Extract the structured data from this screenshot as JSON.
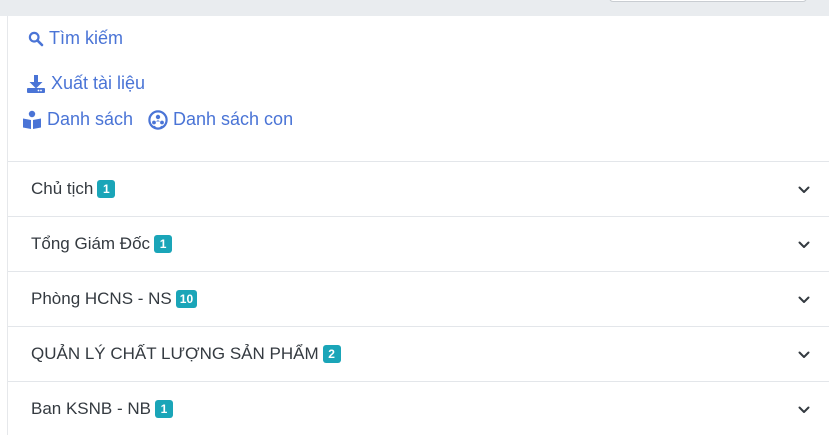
{
  "actions": {
    "search_label": "Tìm kiếm",
    "export_label": "Xuất tài liệu",
    "list_label": "Danh sách",
    "sublist_label": "Danh sách con"
  },
  "colors": {
    "link": "#4a74d6",
    "badge": "#1aa5b8",
    "text": "#343a40",
    "topbar": "#e9ecef"
  },
  "icons": {
    "search": "search-icon",
    "export": "download-icon",
    "list": "book-reader-icon",
    "sublist": "sitemap-globe-icon",
    "expand": "chevron-down-icon"
  },
  "departments": [
    {
      "name": "Chủ tịch",
      "count": "1"
    },
    {
      "name": "Tổng Giám Đốc",
      "count": "1"
    },
    {
      "name": "Phòng HCNS - NS",
      "count": "10"
    },
    {
      "name": "QUẢN LÝ CHẤT LƯỢNG SẢN PHẨM",
      "count": "2"
    },
    {
      "name": "Ban KSNB - NB",
      "count": "1"
    }
  ]
}
